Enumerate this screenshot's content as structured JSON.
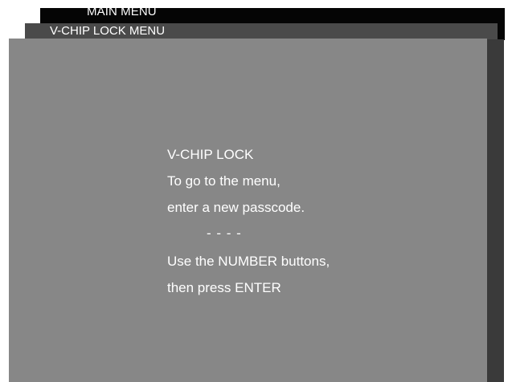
{
  "tabs": {
    "main_menu": "MAIN MENU",
    "vchip_lock_menu": "V-CHIP LOCK MENU"
  },
  "dialog": {
    "title": "V-CHIP LOCK",
    "line1": "To go to the menu,",
    "line2": "enter a new passcode.",
    "passcode": "- - - -",
    "line3": "Use the NUMBER buttons,",
    "line4": "then press ENTER"
  },
  "colors": {
    "main_tab": "#050505",
    "vchip_tab": "#4a4a4a",
    "panel": "#878787",
    "text": "#ffffff"
  }
}
